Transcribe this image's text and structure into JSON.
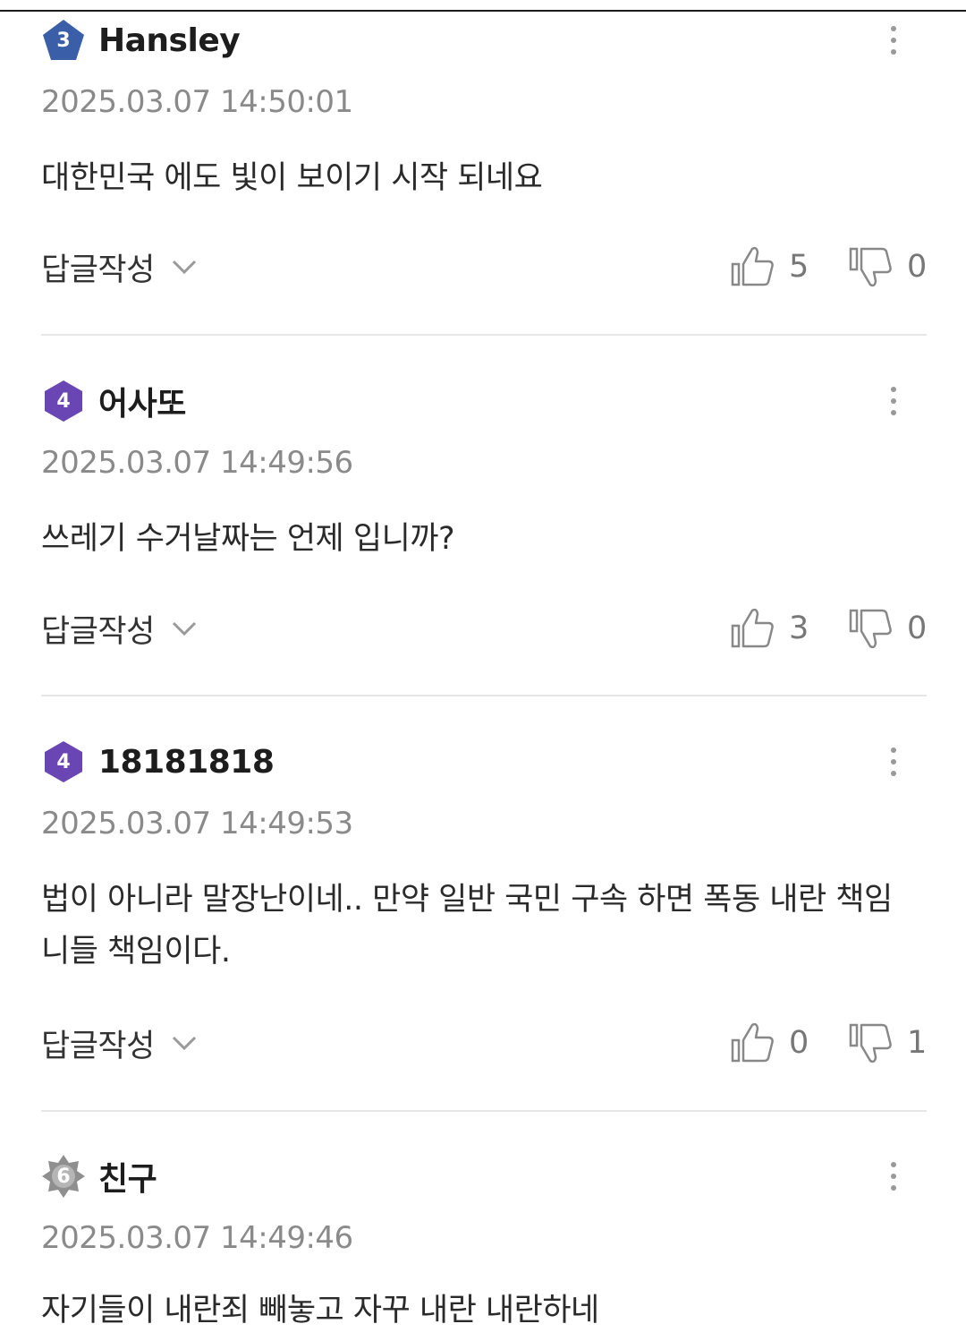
{
  "comments": [
    {
      "level": "3",
      "badge_color": "#3a5fa8",
      "author": "Hansley",
      "timestamp": "2025.03.07 14:50:01",
      "text": "대한민국 에도 빛이 보이기 시작 되네요",
      "reply_label": "답글작성",
      "likes": "5",
      "dislikes": "0"
    },
    {
      "level": "4",
      "badge_color": "#6a46b4",
      "author": "어사또",
      "timestamp": "2025.03.07 14:49:56",
      "text": "쓰레기 수거날짜는 언제 입니까?",
      "reply_label": "답글작성",
      "likes": "3",
      "dislikes": "0"
    },
    {
      "level": "4",
      "badge_color": "#6a46b4",
      "author": "18181818",
      "timestamp": "2025.03.07 14:49:53",
      "text": "법이 아니라 말장난이네.. 만약 일반 국민 구속 하면 폭동 내란 책임 니들 책임이다.",
      "reply_label": "답글작성",
      "likes": "0",
      "dislikes": "1"
    },
    {
      "level": "6",
      "badge_color": "#8f8f8f",
      "author": "친구",
      "timestamp": "2025.03.07 14:49:46",
      "text": "자기들이 내란죄 빼놓고 자꾸 내란 내란하네"
    }
  ]
}
